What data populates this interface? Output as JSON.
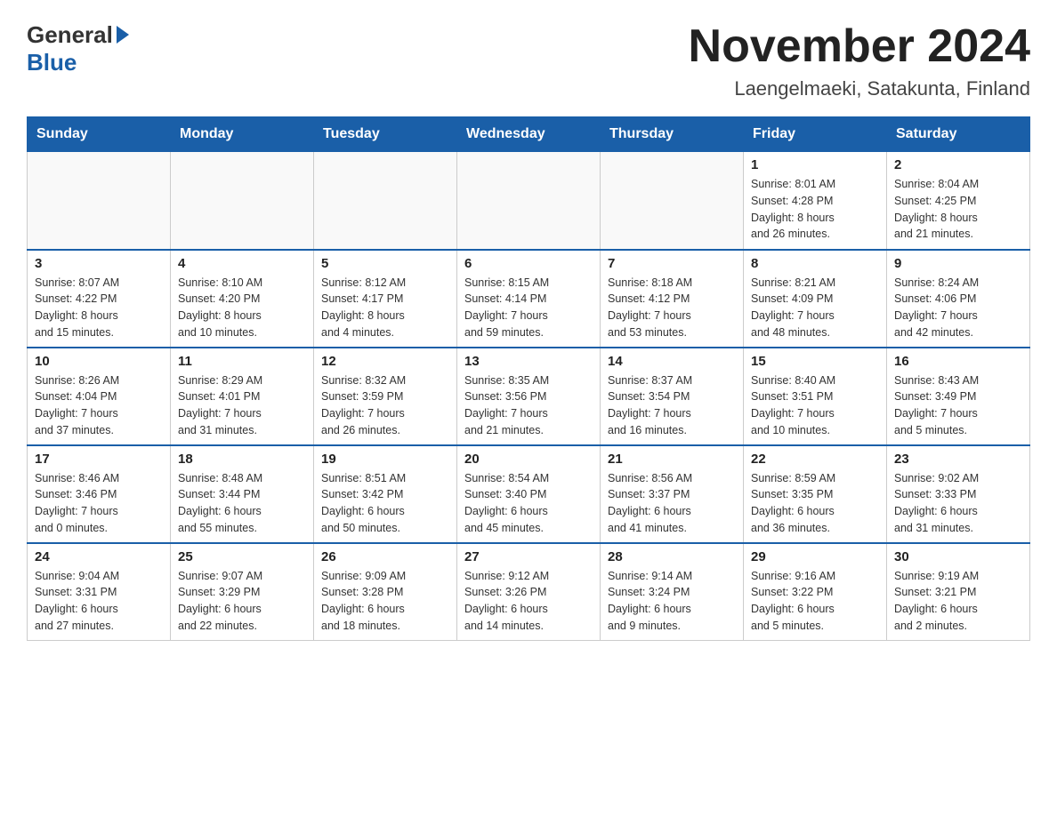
{
  "header": {
    "logo_general": "General",
    "logo_blue": "Blue",
    "month_title": "November 2024",
    "location": "Laengelmaeki, Satakunta, Finland"
  },
  "weekdays": [
    "Sunday",
    "Monday",
    "Tuesday",
    "Wednesday",
    "Thursday",
    "Friday",
    "Saturday"
  ],
  "weeks": [
    [
      {
        "day": "",
        "info": ""
      },
      {
        "day": "",
        "info": ""
      },
      {
        "day": "",
        "info": ""
      },
      {
        "day": "",
        "info": ""
      },
      {
        "day": "",
        "info": ""
      },
      {
        "day": "1",
        "info": "Sunrise: 8:01 AM\nSunset: 4:28 PM\nDaylight: 8 hours\nand 26 minutes."
      },
      {
        "day": "2",
        "info": "Sunrise: 8:04 AM\nSunset: 4:25 PM\nDaylight: 8 hours\nand 21 minutes."
      }
    ],
    [
      {
        "day": "3",
        "info": "Sunrise: 8:07 AM\nSunset: 4:22 PM\nDaylight: 8 hours\nand 15 minutes."
      },
      {
        "day": "4",
        "info": "Sunrise: 8:10 AM\nSunset: 4:20 PM\nDaylight: 8 hours\nand 10 minutes."
      },
      {
        "day": "5",
        "info": "Sunrise: 8:12 AM\nSunset: 4:17 PM\nDaylight: 8 hours\nand 4 minutes."
      },
      {
        "day": "6",
        "info": "Sunrise: 8:15 AM\nSunset: 4:14 PM\nDaylight: 7 hours\nand 59 minutes."
      },
      {
        "day": "7",
        "info": "Sunrise: 8:18 AM\nSunset: 4:12 PM\nDaylight: 7 hours\nand 53 minutes."
      },
      {
        "day": "8",
        "info": "Sunrise: 8:21 AM\nSunset: 4:09 PM\nDaylight: 7 hours\nand 48 minutes."
      },
      {
        "day": "9",
        "info": "Sunrise: 8:24 AM\nSunset: 4:06 PM\nDaylight: 7 hours\nand 42 minutes."
      }
    ],
    [
      {
        "day": "10",
        "info": "Sunrise: 8:26 AM\nSunset: 4:04 PM\nDaylight: 7 hours\nand 37 minutes."
      },
      {
        "day": "11",
        "info": "Sunrise: 8:29 AM\nSunset: 4:01 PM\nDaylight: 7 hours\nand 31 minutes."
      },
      {
        "day": "12",
        "info": "Sunrise: 8:32 AM\nSunset: 3:59 PM\nDaylight: 7 hours\nand 26 minutes."
      },
      {
        "day": "13",
        "info": "Sunrise: 8:35 AM\nSunset: 3:56 PM\nDaylight: 7 hours\nand 21 minutes."
      },
      {
        "day": "14",
        "info": "Sunrise: 8:37 AM\nSunset: 3:54 PM\nDaylight: 7 hours\nand 16 minutes."
      },
      {
        "day": "15",
        "info": "Sunrise: 8:40 AM\nSunset: 3:51 PM\nDaylight: 7 hours\nand 10 minutes."
      },
      {
        "day": "16",
        "info": "Sunrise: 8:43 AM\nSunset: 3:49 PM\nDaylight: 7 hours\nand 5 minutes."
      }
    ],
    [
      {
        "day": "17",
        "info": "Sunrise: 8:46 AM\nSunset: 3:46 PM\nDaylight: 7 hours\nand 0 minutes."
      },
      {
        "day": "18",
        "info": "Sunrise: 8:48 AM\nSunset: 3:44 PM\nDaylight: 6 hours\nand 55 minutes."
      },
      {
        "day": "19",
        "info": "Sunrise: 8:51 AM\nSunset: 3:42 PM\nDaylight: 6 hours\nand 50 minutes."
      },
      {
        "day": "20",
        "info": "Sunrise: 8:54 AM\nSunset: 3:40 PM\nDaylight: 6 hours\nand 45 minutes."
      },
      {
        "day": "21",
        "info": "Sunrise: 8:56 AM\nSunset: 3:37 PM\nDaylight: 6 hours\nand 41 minutes."
      },
      {
        "day": "22",
        "info": "Sunrise: 8:59 AM\nSunset: 3:35 PM\nDaylight: 6 hours\nand 36 minutes."
      },
      {
        "day": "23",
        "info": "Sunrise: 9:02 AM\nSunset: 3:33 PM\nDaylight: 6 hours\nand 31 minutes."
      }
    ],
    [
      {
        "day": "24",
        "info": "Sunrise: 9:04 AM\nSunset: 3:31 PM\nDaylight: 6 hours\nand 27 minutes."
      },
      {
        "day": "25",
        "info": "Sunrise: 9:07 AM\nSunset: 3:29 PM\nDaylight: 6 hours\nand 22 minutes."
      },
      {
        "day": "26",
        "info": "Sunrise: 9:09 AM\nSunset: 3:28 PM\nDaylight: 6 hours\nand 18 minutes."
      },
      {
        "day": "27",
        "info": "Sunrise: 9:12 AM\nSunset: 3:26 PM\nDaylight: 6 hours\nand 14 minutes."
      },
      {
        "day": "28",
        "info": "Sunrise: 9:14 AM\nSunset: 3:24 PM\nDaylight: 6 hours\nand 9 minutes."
      },
      {
        "day": "29",
        "info": "Sunrise: 9:16 AM\nSunset: 3:22 PM\nDaylight: 6 hours\nand 5 minutes."
      },
      {
        "day": "30",
        "info": "Sunrise: 9:19 AM\nSunset: 3:21 PM\nDaylight: 6 hours\nand 2 minutes."
      }
    ]
  ]
}
